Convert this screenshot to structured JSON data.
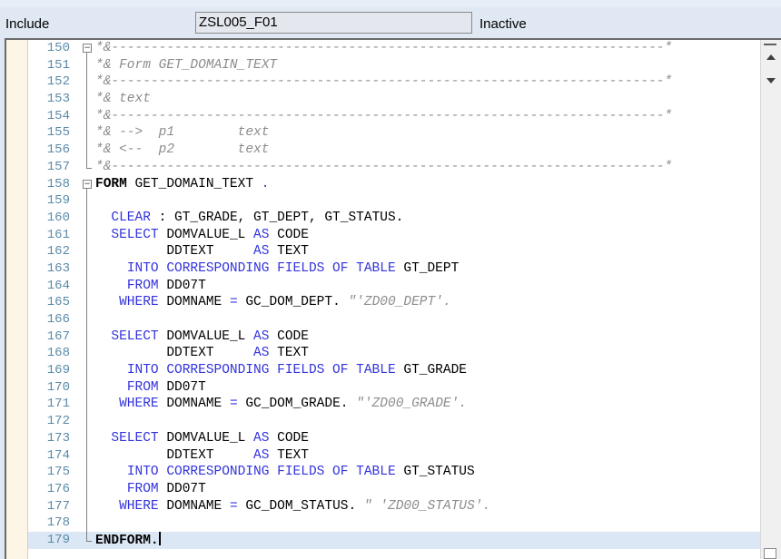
{
  "header": {
    "label": "Include",
    "program": "ZSL005_F01",
    "status": "Inactive"
  },
  "editor": {
    "lines": [
      {
        "num": "150",
        "fold": "start",
        "segs": [
          {
            "t": "*&----------------------------------------------------------------------*",
            "c": "c"
          }
        ]
      },
      {
        "num": "151",
        "fold": "mid",
        "segs": [
          {
            "t": "*& Form GET_DOMAIN_TEXT",
            "c": "c"
          }
        ]
      },
      {
        "num": "152",
        "fold": "mid",
        "segs": [
          {
            "t": "*&----------------------------------------------------------------------*",
            "c": "c"
          }
        ]
      },
      {
        "num": "153",
        "fold": "mid",
        "segs": [
          {
            "t": "*& text",
            "c": "c"
          }
        ]
      },
      {
        "num": "154",
        "fold": "mid",
        "segs": [
          {
            "t": "*&----------------------------------------------------------------------*",
            "c": "c"
          }
        ]
      },
      {
        "num": "155",
        "fold": "mid",
        "segs": [
          {
            "t": "*& -->  p1        text",
            "c": "c"
          }
        ]
      },
      {
        "num": "156",
        "fold": "mid",
        "segs": [
          {
            "t": "*& <--  p2        text",
            "c": "c"
          }
        ]
      },
      {
        "num": "157",
        "fold": "end",
        "segs": [
          {
            "t": "*&----------------------------------------------------------------------*",
            "c": "c"
          }
        ]
      },
      {
        "num": "158",
        "fold": "start",
        "segs": [
          {
            "t": "FORM",
            "c": "b"
          },
          {
            "t": " GET_DOMAIN_TEXT ",
            "c": ""
          },
          {
            "t": ".",
            "c": "k"
          }
        ]
      },
      {
        "num": "159",
        "fold": "mid",
        "segs": []
      },
      {
        "num": "160",
        "fold": "mid",
        "segs": [
          {
            "t": "  ",
            "c": ""
          },
          {
            "t": "CLEAR",
            "c": "k"
          },
          {
            "t": " : ",
            "c": ""
          },
          {
            "t": "GT_GRADE, GT_DEPT, GT_STATUS.",
            "c": ""
          }
        ]
      },
      {
        "num": "161",
        "fold": "mid",
        "segs": [
          {
            "t": "  ",
            "c": ""
          },
          {
            "t": "SELECT",
            "c": "k"
          },
          {
            "t": " DOMVALUE_L ",
            "c": ""
          },
          {
            "t": "AS",
            "c": "k"
          },
          {
            "t": " CODE",
            "c": ""
          }
        ]
      },
      {
        "num": "162",
        "fold": "mid",
        "segs": [
          {
            "t": "         DDTEXT     ",
            "c": ""
          },
          {
            "t": "AS",
            "c": "k"
          },
          {
            "t": " TEXT",
            "c": ""
          }
        ]
      },
      {
        "num": "163",
        "fold": "mid",
        "segs": [
          {
            "t": "    ",
            "c": ""
          },
          {
            "t": "INTO CORRESPONDING FIELDS OF TABLE",
            "c": "k"
          },
          {
            "t": " GT_DEPT",
            "c": ""
          }
        ]
      },
      {
        "num": "164",
        "fold": "mid",
        "segs": [
          {
            "t": "    ",
            "c": ""
          },
          {
            "t": "FROM",
            "c": "k"
          },
          {
            "t": " DD07T",
            "c": ""
          }
        ]
      },
      {
        "num": "165",
        "fold": "mid",
        "segs": [
          {
            "t": "   ",
            "c": ""
          },
          {
            "t": "WHERE",
            "c": "k"
          },
          {
            "t": " DOMNAME ",
            "c": ""
          },
          {
            "t": "=",
            "c": "k"
          },
          {
            "t": " GC_DOM_DEPT. ",
            "c": ""
          },
          {
            "t": "\"'ZD00_DEPT'.",
            "c": "s"
          }
        ]
      },
      {
        "num": "166",
        "fold": "mid",
        "segs": []
      },
      {
        "num": "167",
        "fold": "mid",
        "segs": [
          {
            "t": "  ",
            "c": ""
          },
          {
            "t": "SELECT",
            "c": "k"
          },
          {
            "t": " DOMVALUE_L ",
            "c": ""
          },
          {
            "t": "AS",
            "c": "k"
          },
          {
            "t": " CODE",
            "c": ""
          }
        ]
      },
      {
        "num": "168",
        "fold": "mid",
        "segs": [
          {
            "t": "         DDTEXT     ",
            "c": ""
          },
          {
            "t": "AS",
            "c": "k"
          },
          {
            "t": " TEXT",
            "c": ""
          }
        ]
      },
      {
        "num": "169",
        "fold": "mid",
        "segs": [
          {
            "t": "    ",
            "c": ""
          },
          {
            "t": "INTO CORRESPONDING FIELDS OF TABLE",
            "c": "k"
          },
          {
            "t": " GT_GRADE",
            "c": ""
          }
        ]
      },
      {
        "num": "170",
        "fold": "mid",
        "segs": [
          {
            "t": "    ",
            "c": ""
          },
          {
            "t": "FROM",
            "c": "k"
          },
          {
            "t": " DD07T",
            "c": ""
          }
        ]
      },
      {
        "num": "171",
        "fold": "mid",
        "segs": [
          {
            "t": "   ",
            "c": ""
          },
          {
            "t": "WHERE",
            "c": "k"
          },
          {
            "t": " DOMNAME ",
            "c": ""
          },
          {
            "t": "=",
            "c": "k"
          },
          {
            "t": " GC_DOM_GRADE. ",
            "c": ""
          },
          {
            "t": "\"'ZD00_GRADE'.",
            "c": "s"
          }
        ]
      },
      {
        "num": "172",
        "fold": "mid",
        "segs": []
      },
      {
        "num": "173",
        "fold": "mid",
        "segs": [
          {
            "t": "  ",
            "c": ""
          },
          {
            "t": "SELECT",
            "c": "k"
          },
          {
            "t": " DOMVALUE_L ",
            "c": ""
          },
          {
            "t": "AS",
            "c": "k"
          },
          {
            "t": " CODE",
            "c": ""
          }
        ]
      },
      {
        "num": "174",
        "fold": "mid",
        "segs": [
          {
            "t": "         DDTEXT     ",
            "c": ""
          },
          {
            "t": "AS",
            "c": "k"
          },
          {
            "t": " TEXT",
            "c": ""
          }
        ]
      },
      {
        "num": "175",
        "fold": "mid",
        "segs": [
          {
            "t": "    ",
            "c": ""
          },
          {
            "t": "INTO CORRESPONDING FIELDS OF TABLE",
            "c": "k"
          },
          {
            "t": " GT_STATUS",
            "c": ""
          }
        ]
      },
      {
        "num": "176",
        "fold": "mid",
        "segs": [
          {
            "t": "    ",
            "c": ""
          },
          {
            "t": "FROM",
            "c": "k"
          },
          {
            "t": " DD07T",
            "c": ""
          }
        ]
      },
      {
        "num": "177",
        "fold": "mid",
        "segs": [
          {
            "t": "   ",
            "c": ""
          },
          {
            "t": "WHERE",
            "c": "k"
          },
          {
            "t": " DOMNAME ",
            "c": ""
          },
          {
            "t": "=",
            "c": "k"
          },
          {
            "t": " GC_DOM_STATUS. ",
            "c": ""
          },
          {
            "t": "\" 'ZD00_STATUS'.",
            "c": "s"
          }
        ]
      },
      {
        "num": "178",
        "fold": "mid",
        "segs": []
      },
      {
        "num": "179",
        "fold": "end",
        "cur": true,
        "cursor": true,
        "segs": [
          {
            "t": "ENDFORM.",
            "c": "b"
          }
        ]
      }
    ]
  },
  "colors": {
    "keyword": "#3333dd",
    "comment": "#8c8c8c",
    "line_number": "#5a8aa8",
    "current_line": "#dbe7f5",
    "header_bg": "#dfe8f3"
  },
  "icons": {
    "fold_collapse": "collapse-box-icon",
    "scroll_up": "arrow-up-icon",
    "scroll_down": "arrow-down-icon"
  }
}
